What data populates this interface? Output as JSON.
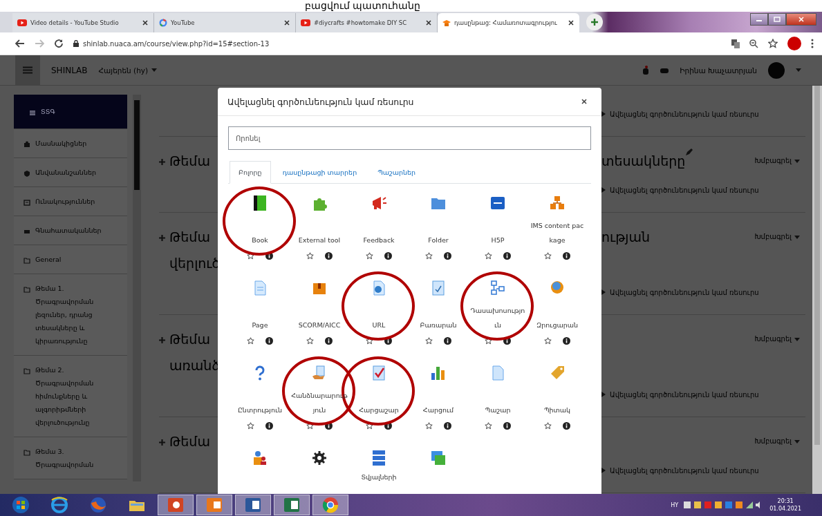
{
  "caption": "բացվում պատուհանը",
  "browser": {
    "tabs": [
      {
        "title": "Video details - YouTube Studio",
        "selected": false
      },
      {
        "title": "YouTube",
        "selected": false
      },
      {
        "title": "#diycrafts #howtomake DIY SC",
        "selected": false
      },
      {
        "title": "դասընթաց: Համառոտագրությու",
        "selected": true
      }
    ],
    "url": "shinlab.nuaca.am/course/view.php?id=15#section-13"
  },
  "navbar": {
    "brand": "SHINLAB",
    "language": "Հայերեն (hy)",
    "user": "Իրինա Խաչատրյան"
  },
  "sidebar": {
    "items": [
      {
        "kind": "dashboard",
        "label": "ՏՏԳ",
        "selected": true
      },
      {
        "kind": "people",
        "label": "Մասնակիցներ",
        "selected": false
      },
      {
        "kind": "badge",
        "label": "Անվանանշաններ",
        "selected": false
      },
      {
        "kind": "checklist",
        "label": "Ունակություններ",
        "selected": false
      },
      {
        "kind": "table",
        "label": "Գնահատականներ",
        "selected": false
      },
      {
        "kind": "folder",
        "label": "General",
        "selected": false
      },
      {
        "kind": "folder",
        "label": "Թեմա 1. Ծրագրավորման լեզուներ, դրանց տեսակները և կիրառությունը",
        "selected": false
      },
      {
        "kind": "folder",
        "label": "Թեմա 2. Ծրագրավորման հիմունքները և ալգորիթմների վերլուծությունը",
        "selected": false
      },
      {
        "kind": "folder",
        "label": "Թեմա 3. Ծրագրավորման",
        "selected": false
      }
    ]
  },
  "course": {
    "top_link": "Ավելացնել գործունեություն կամ ռեսուրս",
    "sections": [
      {
        "title": "Թեմա",
        "title_end": "տեսակները",
        "edit_icon": true,
        "edit_menu": "Խմբագրել",
        "add_link": "Ավելացնել գործունեություն կամ ռեսուրս"
      },
      {
        "title": "Թեմա\nվերլուծ",
        "title_end": "ության",
        "edit_icon": false,
        "edit_menu": "Խմբագրել",
        "add_link": "Ավելացնել գործունեություն կամ ռեսուրս"
      },
      {
        "title": "Թեմա\nառանձ",
        "edit_icon": false,
        "edit_menu": "Խմբագրել",
        "add_link": "Ավելացնել գործունեություն կամ ռեսուրս"
      },
      {
        "title": "Թեմա",
        "edit_icon": false,
        "edit_menu": "Խմբագրել",
        "add_link": "Ավելացնել գործունեություն կամ ռեսուրս"
      }
    ]
  },
  "modal": {
    "title": "Ավելացնել գործունեություն կամ ռեսուրս",
    "search": {
      "placeholder": "Որոնել"
    },
    "tabs": [
      {
        "label": "Բոլորը",
        "selected": true
      },
      {
        "label": "դասընթացի տարրեր",
        "selected": false
      },
      {
        "label": "Պաշարներ",
        "selected": false
      }
    ],
    "items": [
      {
        "kind": "tile",
        "label": "Book",
        "starred": false,
        "highlighted": true
      },
      {
        "kind": "tile",
        "label": "External tool",
        "starred": false,
        "highlighted": false
      },
      {
        "kind": "tile",
        "label": "Feedback",
        "starred": false,
        "highlighted": false
      },
      {
        "kind": "tile",
        "label": "Folder",
        "starred": false,
        "highlighted": false
      },
      {
        "kind": "tile",
        "label": "H5P",
        "starred": false,
        "highlighted": false
      },
      {
        "kind": "tile",
        "label": "IMS content package",
        "starred": false,
        "highlighted": false
      },
      {
        "kind": "tile",
        "label": "Page",
        "starred": false,
        "highlighted": false
      },
      {
        "kind": "tile",
        "label": "SCORM/AICC",
        "starred": false,
        "highlighted": false
      },
      {
        "kind": "tile",
        "label": "URL",
        "starred": false,
        "highlighted": true
      },
      {
        "kind": "tile",
        "label": "Բառարան",
        "starred": false,
        "highlighted": false
      },
      {
        "kind": "tile",
        "label": "Դասախոսություն",
        "starred": false,
        "highlighted": true
      },
      {
        "kind": "tile",
        "label": "Զրուցարան",
        "starred": false,
        "highlighted": false
      },
      {
        "kind": "tile",
        "label": "Ընտրություն",
        "starred": false,
        "highlighted": false
      },
      {
        "kind": "tile",
        "label": "Հանձնարարություն",
        "starred": false,
        "highlighted": true
      },
      {
        "kind": "tile",
        "label": "Հարցաշար",
        "starred": false,
        "highlighted": true
      },
      {
        "kind": "tile",
        "label": "Հարցում",
        "starred": false,
        "highlighted": false
      },
      {
        "kind": "tile",
        "label": "Պաշար",
        "starred": false,
        "highlighted": false
      },
      {
        "kind": "tile",
        "label": "Պիտակ",
        "starred": false,
        "highlighted": false
      },
      {
        "kind": "cut",
        "highlighted": false
      },
      {
        "kind": "cut",
        "highlighted": false
      },
      {
        "kind": "cut",
        "label": "Տվյալների",
        "highlighted": false
      },
      {
        "kind": "cut",
        "highlighted": false
      }
    ]
  },
  "taskbar": {
    "language": "HY",
    "time": "20:31",
    "date": "01.04.2021"
  }
}
